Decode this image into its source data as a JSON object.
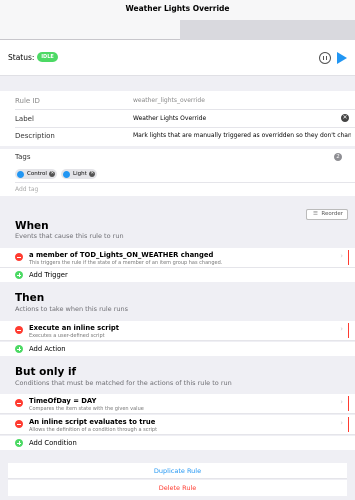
{
  "navbar": {
    "title": "Weather Lights Override"
  },
  "status": {
    "label": "Status:",
    "badge": "IDLE"
  },
  "details": {
    "rule_id_label": "Rule ID",
    "rule_id_value": "weather_lights_override",
    "label_label": "Label",
    "label_value": "Weather Lights Override",
    "description_label": "Description",
    "description_value": "Mark lights that are manually triggered as overridden so they don't change"
  },
  "tags": {
    "label": "Tags",
    "count": "2",
    "items": [
      "Control",
      "Light"
    ],
    "add_placeholder": "Add tag"
  },
  "reorder_label": "Reorder",
  "when": {
    "title": "When",
    "subtitle": "Events that cause this rule to run",
    "items": [
      {
        "title": "a member of TOD_Lights_ON_WEATHER changed",
        "subtitle": "This triggers the rule if the state of a member of an item group has changed."
      }
    ],
    "add_label": "Add Trigger"
  },
  "then": {
    "title": "Then",
    "subtitle": "Actions to take when this rule runs",
    "items": [
      {
        "title": "Execute an inline script",
        "subtitle": "Executes a user-defined script"
      }
    ],
    "add_label": "Add Action"
  },
  "but_only_if": {
    "title": "But only if",
    "subtitle": "Conditions that must be matched for the actions of this rule to run",
    "items": [
      {
        "title": "TimeOfDay = DAY",
        "subtitle": "Compares the item state with the given value"
      },
      {
        "title": "An inline script evaluates to true",
        "subtitle": "Allows the definition of a condition through a script"
      }
    ],
    "add_label": "Add Condition"
  },
  "actions": {
    "duplicate": "Duplicate Rule",
    "delete": "Delete Rule"
  },
  "colors": {
    "accent": "#2196f3",
    "danger": "#ff3b30",
    "success": "#4cd964"
  }
}
